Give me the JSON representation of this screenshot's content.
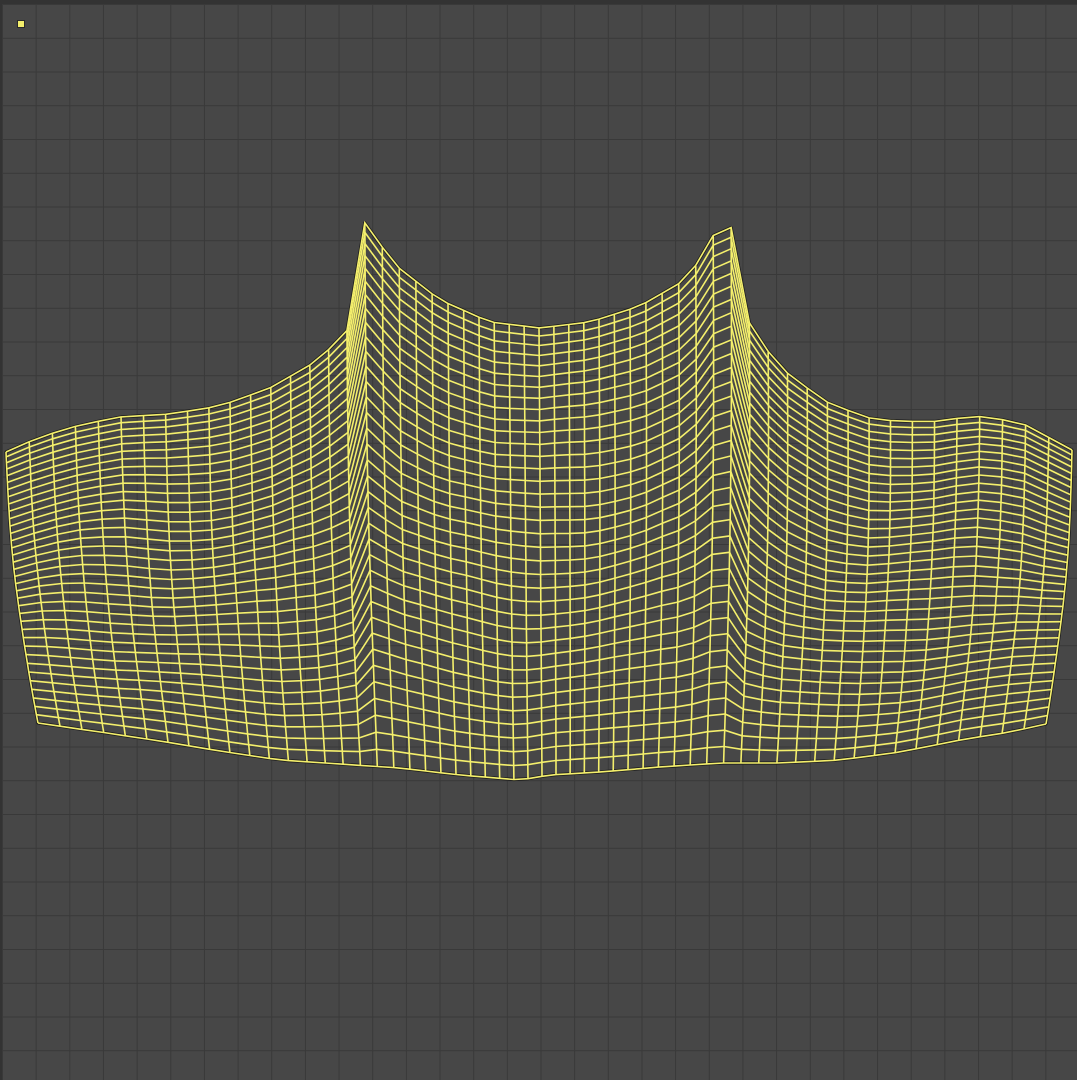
{
  "viewport": {
    "name": "uv-editor",
    "background_color": "#474747",
    "grid_line_color": "#393939",
    "grid_divisions": 32
  },
  "uv_island": {
    "name": "shirt-front-panel",
    "wire_color": "#f4ef6c",
    "outline_color": "#1e1e1e",
    "columns": 56,
    "rows": 36
  },
  "corner_marker": {
    "icon": "selected-vertex-icon",
    "color": "#f4ef6c"
  }
}
